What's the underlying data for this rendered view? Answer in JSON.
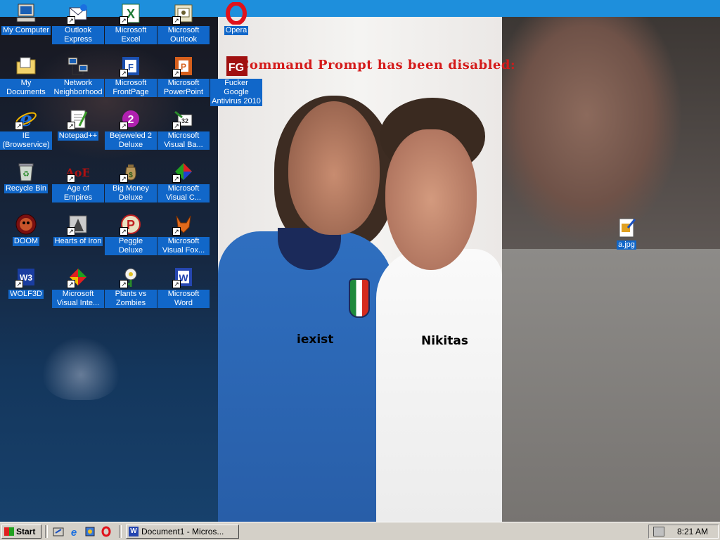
{
  "wallpaper": {
    "warning_text": "Command Prompt has been disabled:",
    "person_left_name": "iexist",
    "person_right_name": "Nikitas"
  },
  "desktop_icons": [
    {
      "label": "My Computer",
      "icon": "my-computer-icon"
    },
    {
      "label": "Outlook Express",
      "icon": "outlook-express-icon"
    },
    {
      "label": "Microsoft Excel",
      "icon": "excel-icon"
    },
    {
      "label": "Microsoft Outlook",
      "icon": "outlook-icon"
    },
    {
      "label": "Opera",
      "icon": "opera-icon"
    },
    {
      "label": "My Documents",
      "icon": "my-documents-icon"
    },
    {
      "label": "Network Neighborhood",
      "icon": "network-neighborhood-icon"
    },
    {
      "label": "Microsoft FrontPage",
      "icon": "frontpage-icon"
    },
    {
      "label": "Microsoft PowerPoint",
      "icon": "powerpoint-icon"
    },
    {
      "label": "Fucker Google Antivirus 2010",
      "icon": "antivirus-icon"
    },
    {
      "label": "IE (Browservice)",
      "icon": "internet-explorer-icon"
    },
    {
      "label": "Notepad++",
      "icon": "notepad-plus-plus-icon"
    },
    {
      "label": "Bejeweled 2 Deluxe",
      "icon": "bejeweled-icon"
    },
    {
      "label": "Microsoft Visual Ba...",
      "icon": "visual-basic-icon"
    },
    {
      "label": "Recycle Bin",
      "icon": "recycle-bin-icon"
    },
    {
      "label": "Age of Empires",
      "icon": "age-of-empires-icon"
    },
    {
      "label": "Big Money Deluxe",
      "icon": "big-money-icon"
    },
    {
      "label": "Microsoft Visual C...",
      "icon": "visual-c-icon"
    },
    {
      "label": "DOOM",
      "icon": "doom-icon"
    },
    {
      "label": "Hearts of Iron",
      "icon": "hearts-of-iron-icon"
    },
    {
      "label": "Peggle Deluxe",
      "icon": "peggle-icon"
    },
    {
      "label": "Microsoft Visual Fox...",
      "icon": "visual-foxpro-icon"
    },
    {
      "label": "WOLF3D",
      "icon": "wolf3d-icon"
    },
    {
      "label": "Microsoft Visual Inte...",
      "icon": "visual-interdev-icon"
    },
    {
      "label": "Plants vs Zombies",
      "icon": "plants-vs-zombies-icon"
    },
    {
      "label": "Microsoft Word",
      "icon": "word-icon"
    },
    {
      "label": "a.jpg",
      "icon": "image-file-icon"
    }
  ],
  "taskbar": {
    "start_label": "Start",
    "quick_launch": [
      "show-desktop-icon",
      "internet-explorer-icon",
      "channels-icon",
      "opera-icon"
    ],
    "task_label": "Document1 - Micros...",
    "clock": "8:21 AM"
  }
}
